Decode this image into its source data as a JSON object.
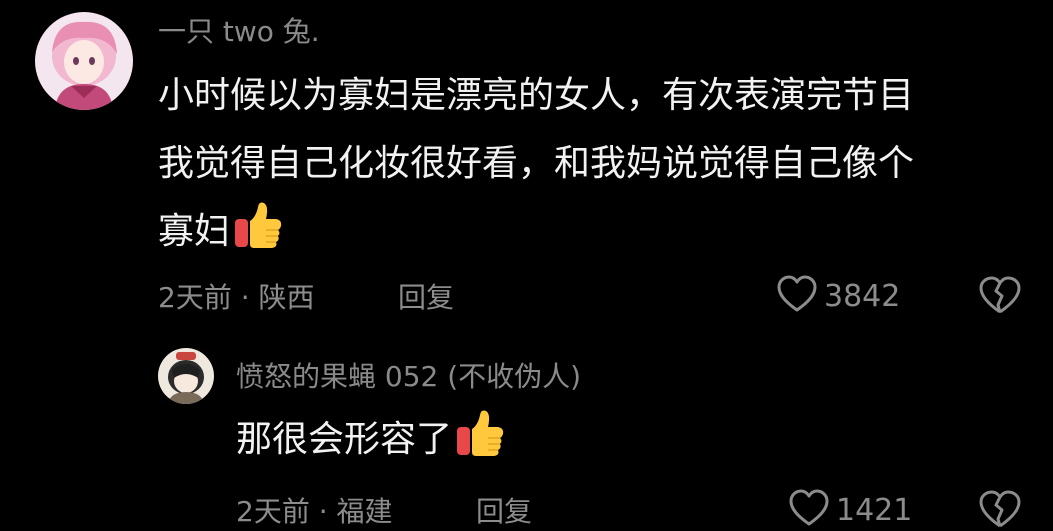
{
  "comment": {
    "username": "一只 two 兔.",
    "lines": [
      "小时候以为寡妇是漂亮的女人，有次表演完节目",
      "我觉得自己化妆很好看，和我妈说觉得自己像个",
      "寡妇"
    ],
    "emoji_icon": "thumbs-up-icon",
    "time": "2天前",
    "separator": "·",
    "location": "陕西",
    "reply_label": "回复",
    "like_count": "3842"
  },
  "reply": {
    "username": "愤怒的果蝇 052 (不收伪人)",
    "text": "那很会形容了",
    "emoji_icon": "thumbs-up-icon",
    "time": "2天前",
    "separator": "·",
    "location": "福建",
    "reply_label": "回复",
    "like_count": "1421"
  },
  "colors": {
    "background": "#000000",
    "text_primary": "#f2f2f2",
    "text_secondary": "#8c8c8c",
    "thumb_yellow": "#ffc83d",
    "thumb_red": "#e8484a"
  }
}
